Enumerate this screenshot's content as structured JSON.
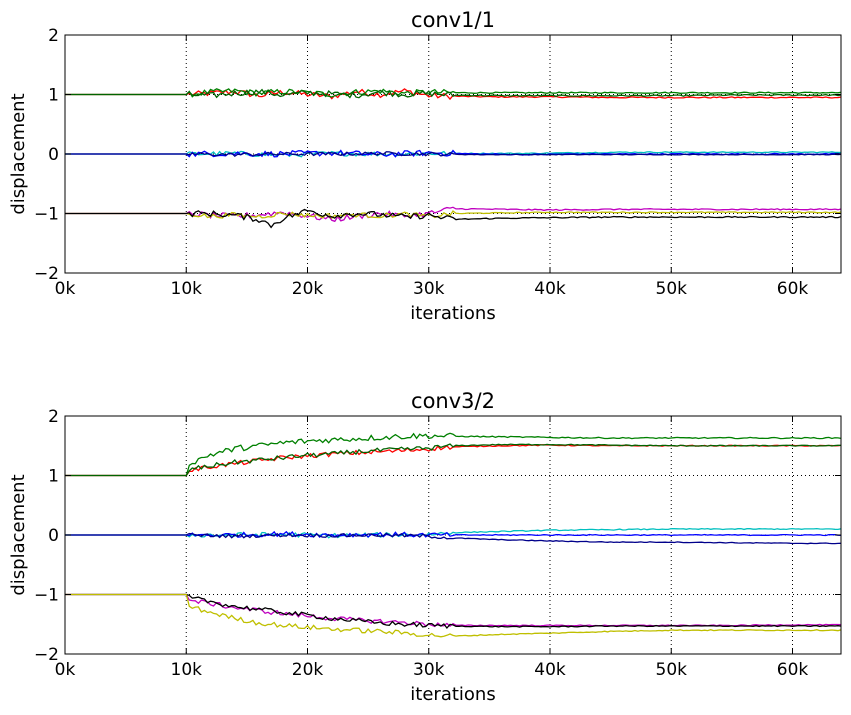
{
  "chart_data": [
    {
      "type": "line",
      "title": "conv1/1",
      "xlabel": "iterations",
      "ylabel": "displacement",
      "xlim": [
        0,
        64000
      ],
      "ylim": [
        -2,
        2
      ],
      "xticks": [
        0,
        10000,
        20000,
        30000,
        40000,
        50000,
        60000
      ],
      "xtick_labels": [
        "0k",
        "10k",
        "20k",
        "30k",
        "40k",
        "50k",
        "60k"
      ],
      "yticks": [
        -2,
        -1,
        0,
        1,
        2
      ],
      "ytick_labels": [
        "−2",
        "−1",
        "0",
        "1",
        "2"
      ],
      "grid": true,
      "series": [
        {
          "color": "#ff0000",
          "x": [
            0,
            10000,
            12000,
            14000,
            16000,
            18000,
            20000,
            22000,
            24000,
            26000,
            28000,
            30000,
            32000,
            36000,
            40000,
            45000,
            50000,
            55000,
            60000,
            64000
          ],
          "y": [
            1,
            1,
            1.02,
            1.05,
            0.98,
            1.04,
            1.0,
            0.97,
            1.05,
            1.0,
            1.06,
            0.98,
            0.97,
            0.96,
            0.96,
            0.95,
            0.95,
            0.95,
            0.95,
            0.95
          ],
          "noise": 0.05
        },
        {
          "color": "#008000",
          "x": [
            0,
            10000,
            12000,
            14000,
            16000,
            18000,
            20000,
            22000,
            24000,
            26000,
            28000,
            30000,
            32000,
            36000,
            40000,
            45000,
            50000,
            55000,
            60000,
            64000
          ],
          "y": [
            1,
            1,
            1.04,
            1.06,
            1.02,
            1.05,
            1.03,
            1.0,
            1.04,
            1.06,
            1.02,
            1.04,
            1.03,
            1.03,
            1.03,
            1.03,
            1.03,
            1.03,
            1.03,
            1.03
          ],
          "noise": 0.05
        },
        {
          "color": "#006400",
          "x": [
            0,
            10000,
            12000,
            14000,
            16000,
            18000,
            20000,
            22000,
            24000,
            26000,
            28000,
            30000,
            32000,
            36000,
            40000,
            45000,
            50000,
            55000,
            60000,
            64000
          ],
          "y": [
            1,
            1,
            0.98,
            1.02,
            1.05,
            0.99,
            1.03,
            1.01,
            0.99,
            1.04,
            1.0,
            1.02,
            0.99,
            0.98,
            0.98,
            0.98,
            0.98,
            0.99,
            0.99,
            0.99
          ],
          "noise": 0.05
        },
        {
          "color": "#00bfbf",
          "x": [
            0,
            10000,
            14000,
            18000,
            22000,
            26000,
            30000,
            34000,
            38000,
            42000,
            46000,
            50000,
            54000,
            58000,
            62000,
            64000
          ],
          "y": [
            0,
            0,
            0.01,
            -0.02,
            0.01,
            0.0,
            0.01,
            0.01,
            0.01,
            0.02,
            0.03,
            0.03,
            0.03,
            0.03,
            0.03,
            0.03
          ],
          "noise": 0.04
        },
        {
          "color": "#0000ff",
          "x": [
            0,
            10000,
            14000,
            18000,
            22000,
            26000,
            30000,
            34000,
            38000,
            42000,
            46000,
            50000,
            54000,
            58000,
            62000,
            64000
          ],
          "y": [
            0,
            0,
            0.01,
            0.0,
            0.02,
            -0.01,
            0.02,
            0.0,
            -0.01,
            0.0,
            0.0,
            0.0,
            0.0,
            0.0,
            0.0,
            0.0
          ],
          "noise": 0.05
        },
        {
          "color": "#00008b",
          "x": [
            0,
            10000,
            14000,
            18000,
            22000,
            26000,
            30000,
            34000,
            38000,
            42000,
            46000,
            50000,
            54000,
            58000,
            62000,
            64000
          ],
          "y": [
            0,
            0,
            -0.01,
            0.0,
            0.0,
            0.01,
            0.0,
            -0.01,
            -0.01,
            -0.01,
            -0.01,
            -0.01,
            -0.01,
            -0.01,
            -0.01,
            -0.01
          ],
          "noise": 0.03
        },
        {
          "color": "#bf00bf",
          "x": [
            0,
            10000,
            12000,
            14000,
            16000,
            18000,
            20000,
            22000,
            24000,
            26000,
            28000,
            30000,
            32000,
            36000,
            40000,
            45000,
            50000,
            55000,
            60000,
            64000
          ],
          "y": [
            -1,
            -1,
            -1.03,
            -1.05,
            -1.02,
            -0.98,
            -1.04,
            -1.1,
            -1.05,
            -1.0,
            -1.04,
            -1.0,
            -0.92,
            -0.93,
            -0.94,
            -0.93,
            -0.93,
            -0.93,
            -0.93,
            -0.93
          ],
          "noise": 0.05
        },
        {
          "color": "#bfbf00",
          "x": [
            0,
            10000,
            12000,
            14000,
            16000,
            18000,
            20000,
            22000,
            24000,
            26000,
            28000,
            30000,
            32000,
            36000,
            40000,
            45000,
            50000,
            55000,
            60000,
            64000
          ],
          "y": [
            -1,
            -1,
            -1.05,
            -1.02,
            -1.05,
            -1.0,
            -1.03,
            -1.04,
            -1.02,
            -1.04,
            -1.01,
            -1.05,
            -1.0,
            -0.99,
            -0.98,
            -0.98,
            -0.98,
            -0.98,
            -0.98,
            -0.98
          ],
          "noise": 0.04
        },
        {
          "color": "#000000",
          "x": [
            0,
            10000,
            12000,
            14000,
            16000,
            17000,
            18000,
            20000,
            22000,
            24000,
            26000,
            28000,
            30000,
            32000,
            36000,
            40000,
            45000,
            50000,
            55000,
            60000,
            64000
          ],
          "y": [
            -1,
            -1,
            -1.0,
            -1.03,
            -1.1,
            -1.2,
            -1.08,
            -0.95,
            -1.04,
            -1.0,
            -1.02,
            -1.06,
            -1.03,
            -1.1,
            -1.08,
            -1.07,
            -1.06,
            -1.06,
            -1.06,
            -1.06,
            -1.06
          ],
          "noise": 0.05
        }
      ]
    },
    {
      "type": "line",
      "title": "conv3/2",
      "xlabel": "iterations",
      "ylabel": "displacement",
      "xlim": [
        0,
        64000
      ],
      "ylim": [
        -2,
        2
      ],
      "xticks": [
        0,
        10000,
        20000,
        30000,
        40000,
        50000,
        60000
      ],
      "xtick_labels": [
        "0k",
        "10k",
        "20k",
        "30k",
        "40k",
        "50k",
        "60k"
      ],
      "yticks": [
        -2,
        -1,
        0,
        1,
        2
      ],
      "ytick_labels": [
        "−2",
        "−1",
        "0",
        "1",
        "2"
      ],
      "grid": true,
      "series": [
        {
          "color": "#008000",
          "x": [
            0,
            10000,
            10200,
            12000,
            14000,
            16000,
            18000,
            20000,
            22000,
            24000,
            26000,
            28000,
            30000,
            32000,
            36000,
            40000,
            45000,
            50000,
            55000,
            60000,
            64000
          ],
          "y": [
            1,
            1,
            1.2,
            1.35,
            1.45,
            1.5,
            1.55,
            1.58,
            1.6,
            1.62,
            1.64,
            1.66,
            1.67,
            1.66,
            1.65,
            1.64,
            1.63,
            1.63,
            1.63,
            1.63,
            1.63
          ],
          "noise": 0.05
        },
        {
          "color": "#ff0000",
          "x": [
            0,
            10000,
            10200,
            12000,
            14000,
            16000,
            18000,
            20000,
            22000,
            24000,
            26000,
            28000,
            30000,
            32000,
            36000,
            40000,
            45000,
            50000,
            55000,
            60000,
            64000
          ],
          "y": [
            1,
            1,
            1.08,
            1.15,
            1.2,
            1.25,
            1.3,
            1.33,
            1.36,
            1.38,
            1.4,
            1.42,
            1.45,
            1.48,
            1.5,
            1.51,
            1.5,
            1.5,
            1.5,
            1.5,
            1.5
          ],
          "noise": 0.04
        },
        {
          "color": "#006400",
          "x": [
            0,
            10000,
            10200,
            12000,
            14000,
            16000,
            18000,
            20000,
            22000,
            24000,
            26000,
            28000,
            30000,
            32000,
            36000,
            40000,
            45000,
            50000,
            55000,
            60000,
            64000
          ],
          "y": [
            1,
            1,
            1.1,
            1.16,
            1.22,
            1.26,
            1.3,
            1.34,
            1.36,
            1.4,
            1.42,
            1.44,
            1.46,
            1.5,
            1.52,
            1.52,
            1.51,
            1.5,
            1.5,
            1.5,
            1.5
          ],
          "noise": 0.04
        },
        {
          "color": "#00bfbf",
          "x": [
            0,
            10000,
            14000,
            18000,
            22000,
            26000,
            30000,
            32000,
            36000,
            40000,
            45000,
            50000,
            55000,
            60000,
            64000
          ],
          "y": [
            0,
            0,
            0.0,
            0.01,
            -0.01,
            0.0,
            0.01,
            0.04,
            0.06,
            0.08,
            0.09,
            0.1,
            0.1,
            0.1,
            0.1
          ],
          "noise": 0.04
        },
        {
          "color": "#0000ff",
          "x": [
            0,
            10000,
            14000,
            18000,
            22000,
            26000,
            30000,
            32000,
            36000,
            40000,
            45000,
            50000,
            55000,
            60000,
            64000
          ],
          "y": [
            0,
            0,
            0.0,
            0.02,
            0.0,
            0.01,
            0.0,
            0.0,
            0.0,
            0.0,
            0.0,
            0.0,
            0.0,
            0.0,
            0.0
          ],
          "noise": 0.04
        },
        {
          "color": "#00008b",
          "x": [
            0,
            10000,
            14000,
            18000,
            22000,
            26000,
            30000,
            32000,
            36000,
            40000,
            45000,
            50000,
            55000,
            60000,
            64000
          ],
          "y": [
            0,
            0,
            -0.02,
            0.0,
            -0.01,
            0.0,
            -0.02,
            -0.05,
            -0.08,
            -0.1,
            -0.12,
            -0.12,
            -0.13,
            -0.14,
            -0.14
          ],
          "noise": 0.03
        },
        {
          "color": "#bf00bf",
          "x": [
            0,
            10000,
            10200,
            12000,
            14000,
            16000,
            18000,
            20000,
            22000,
            24000,
            26000,
            28000,
            30000,
            32000,
            36000,
            40000,
            45000,
            50000,
            55000,
            60000,
            64000
          ],
          "y": [
            -1,
            -1,
            -1.1,
            -1.15,
            -1.22,
            -1.27,
            -1.32,
            -1.36,
            -1.4,
            -1.43,
            -1.45,
            -1.47,
            -1.5,
            -1.52,
            -1.52,
            -1.52,
            -1.52,
            -1.52,
            -1.52,
            -1.51,
            -1.51
          ],
          "noise": 0.04
        },
        {
          "color": "#000000",
          "x": [
            0,
            10000,
            10200,
            12000,
            14000,
            16000,
            18000,
            20000,
            22000,
            24000,
            26000,
            28000,
            30000,
            32000,
            36000,
            40000,
            45000,
            50000,
            55000,
            60000,
            64000
          ],
          "y": [
            -1,
            -1,
            -1.05,
            -1.12,
            -1.2,
            -1.25,
            -1.3,
            -1.35,
            -1.4,
            -1.44,
            -1.48,
            -1.5,
            -1.52,
            -1.53,
            -1.54,
            -1.54,
            -1.53,
            -1.53,
            -1.53,
            -1.53,
            -1.53
          ],
          "noise": 0.04
        },
        {
          "color": "#bfbf00",
          "x": [
            0,
            10000,
            10200,
            12000,
            14000,
            16000,
            18000,
            20000,
            22000,
            24000,
            26000,
            28000,
            30000,
            32000,
            36000,
            40000,
            45000,
            50000,
            55000,
            60000,
            64000
          ],
          "y": [
            -1,
            -1,
            -1.2,
            -1.3,
            -1.4,
            -1.48,
            -1.52,
            -1.55,
            -1.58,
            -1.6,
            -1.62,
            -1.65,
            -1.68,
            -1.7,
            -1.67,
            -1.65,
            -1.62,
            -1.6,
            -1.6,
            -1.6,
            -1.6
          ],
          "noise": 0.04
        }
      ]
    }
  ]
}
